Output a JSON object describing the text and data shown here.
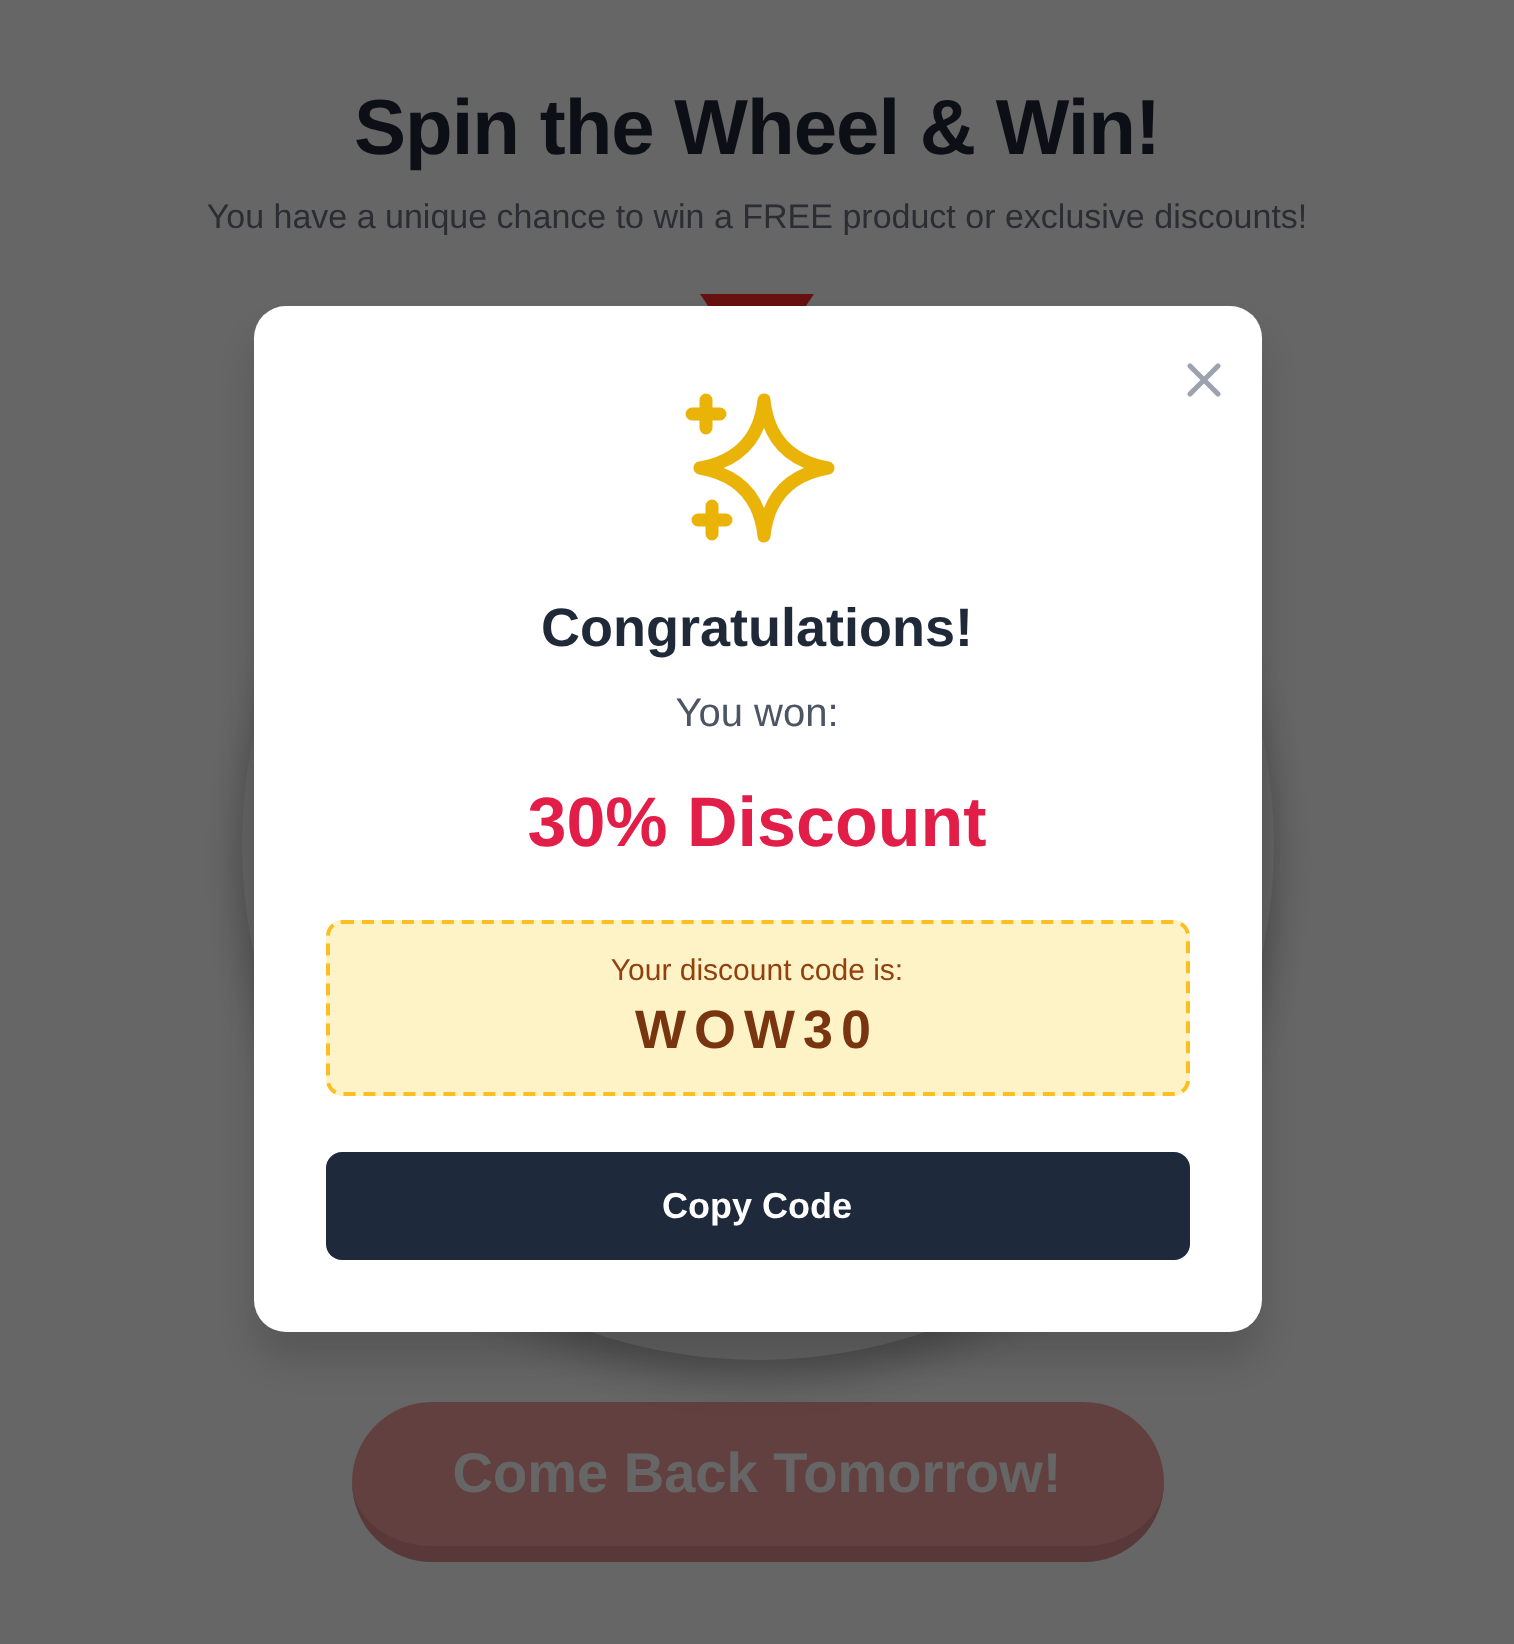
{
  "page": {
    "title": "Spin the Wheel & Win!",
    "subtitle": "You have a unique chance to win a FREE product or exclusive discounts!",
    "spin_button": {
      "label": "Come Back Tomorrow!",
      "disabled": true
    }
  },
  "modal": {
    "title": "Congratulations!",
    "prize_label": "You won:",
    "prize": "30% Discount",
    "code_box": {
      "label": "Your discount code is:",
      "code": "WOW30"
    },
    "copy_button": {
      "label": "Copy Code"
    }
  }
}
